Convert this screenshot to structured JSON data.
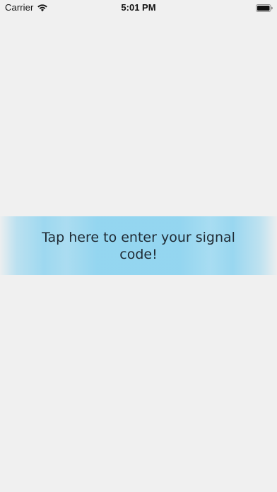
{
  "status_bar": {
    "carrier": "Carrier",
    "time": "5:01 PM",
    "wifi_icon": "wifi-icon",
    "battery_icon": "battery-icon"
  },
  "banner": {
    "label": "Tap here to enter your signal code!",
    "color": "#8fd4f0"
  },
  "colors": {
    "background": "#f0f0f0",
    "text": "#1f2a33"
  }
}
